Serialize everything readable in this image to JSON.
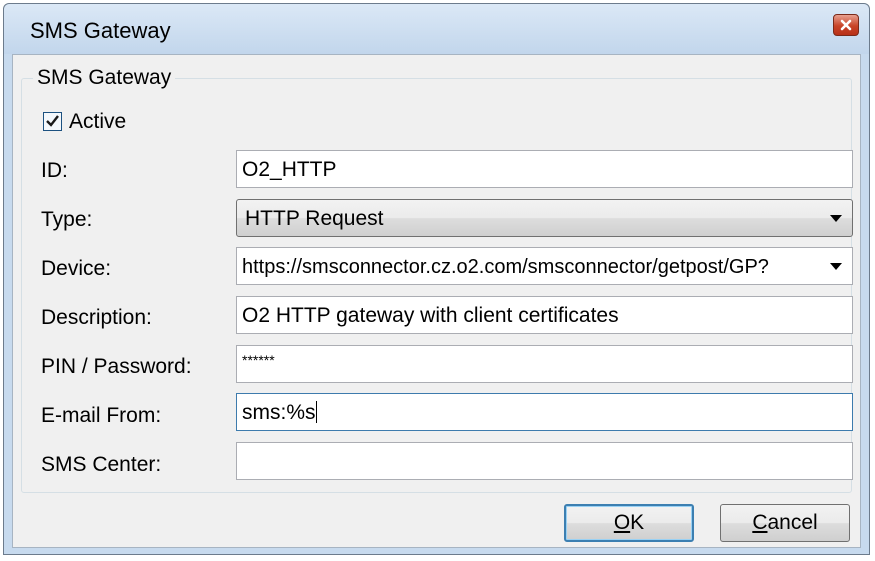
{
  "window": {
    "title": "SMS Gateway"
  },
  "group": {
    "label": "SMS Gateway"
  },
  "active": {
    "label": "Active",
    "checked": true
  },
  "fields": {
    "id": {
      "label": "ID:",
      "value": "O2_HTTP"
    },
    "type": {
      "label": "Type:",
      "value": "HTTP Request"
    },
    "device": {
      "label": "Device:",
      "value": "https://smsconnector.cz.o2.com/smsconnector/getpost/GP?"
    },
    "description": {
      "label": "Description:",
      "value": "O2 HTTP gateway with client certificates"
    },
    "pin": {
      "label": "PIN / Password:",
      "value": "******"
    },
    "email_from": {
      "label": "E-mail From:",
      "value": "sms:%s"
    },
    "sms_center": {
      "label": "SMS Center:",
      "value": ""
    }
  },
  "buttons": {
    "ok": {
      "mnemonic": "O",
      "rest": "K"
    },
    "cancel": {
      "mnemonic": "C",
      "rest": "ancel"
    }
  },
  "icons": {
    "close": "close-icon",
    "combo_arrow": "chevron-down-icon",
    "check": "checkmark-icon"
  },
  "colors": {
    "titlebar": "#c7daee",
    "close_button": "#c84428",
    "default_button_border": "#3c7fb1"
  }
}
